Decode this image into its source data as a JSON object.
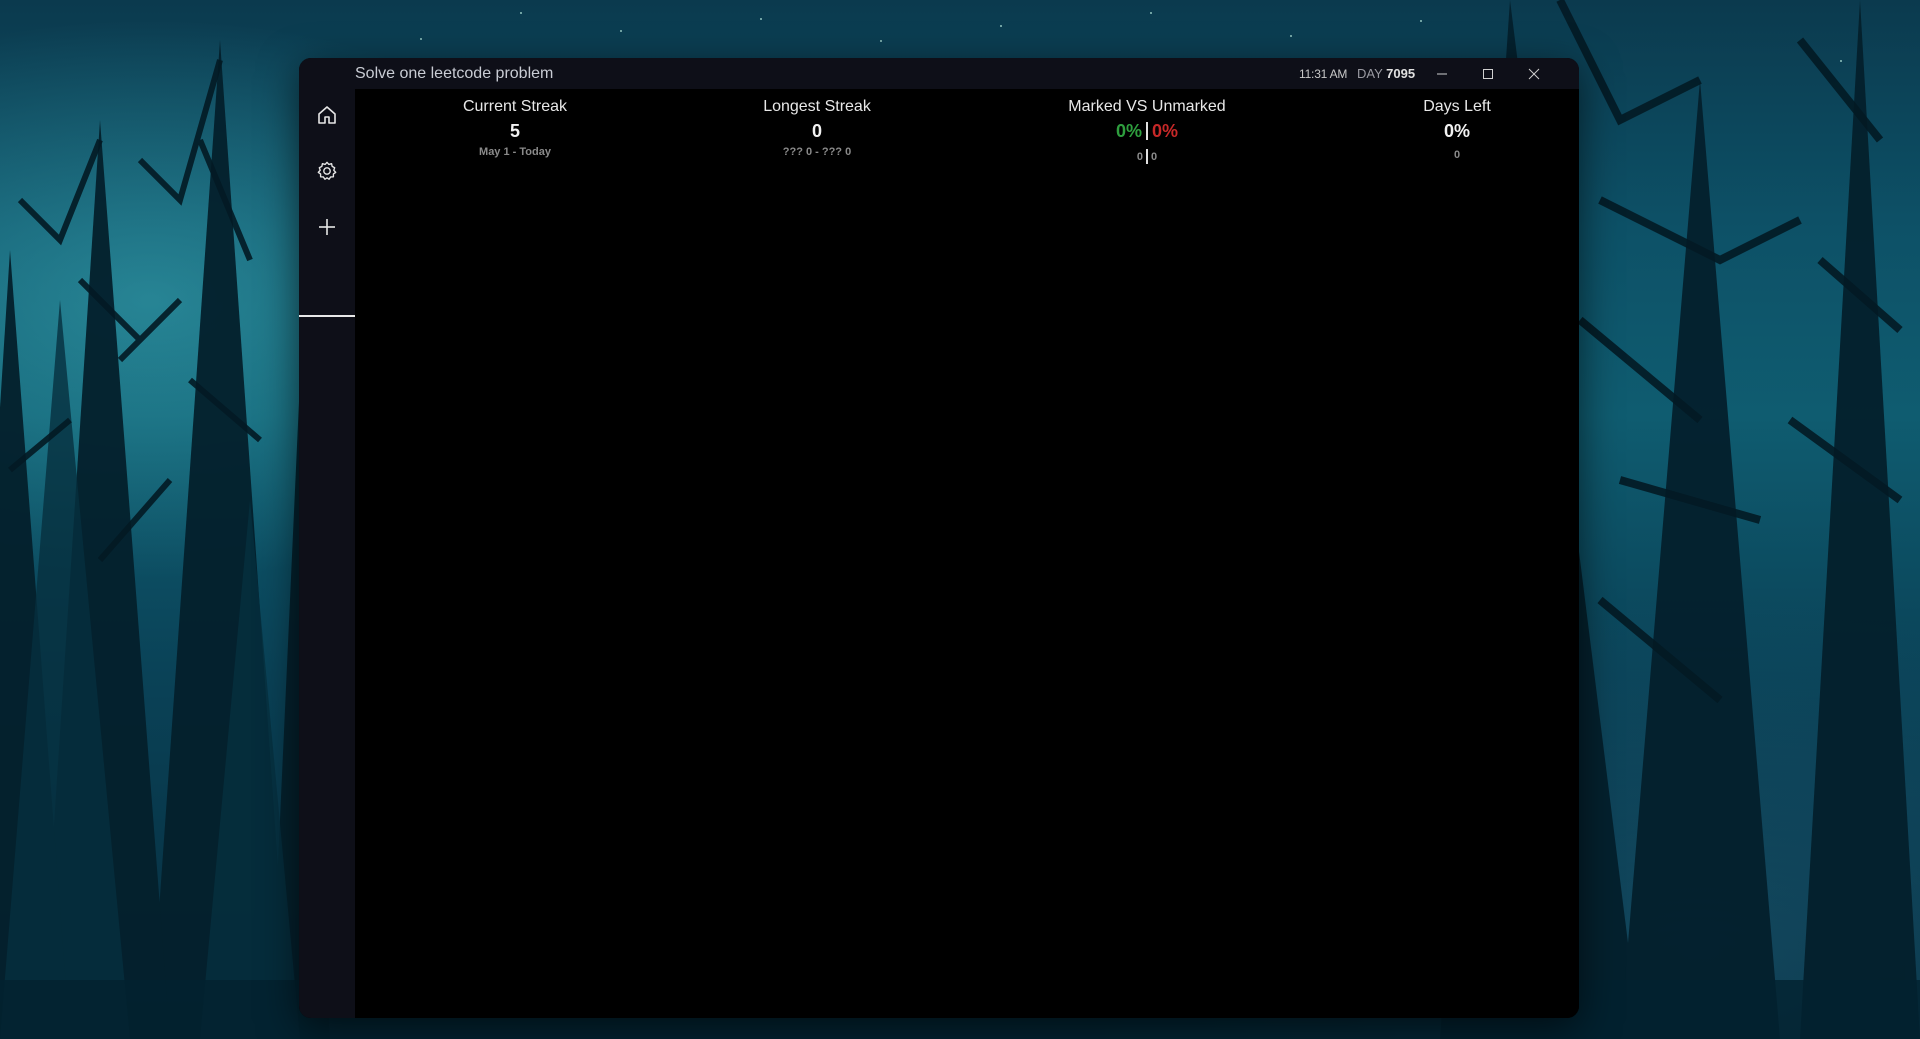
{
  "window": {
    "title": "Solve one leetcode problem",
    "time": "11:31 AM",
    "day_label": "DAY",
    "day_number": "7095"
  },
  "window_controls": {
    "minimize_icon": "minimize-icon",
    "maximize_icon": "maximize-icon",
    "close_icon": "close-icon"
  },
  "sidebar": {
    "items": [
      {
        "icon": "home-icon",
        "selected": false
      },
      {
        "icon": "gear-icon",
        "selected": false
      },
      {
        "icon": "plus-icon",
        "selected": true
      }
    ]
  },
  "stats": {
    "current_streak": {
      "title": "Current Streak",
      "value": "5",
      "range": "May 1 - Today"
    },
    "longest_streak": {
      "title": "Longest Streak",
      "value": "0",
      "range": "??? 0 - ??? 0"
    },
    "marked_vs_unmarked": {
      "title": "Marked VS Unmarked",
      "marked_pct": "0%",
      "unmarked_pct": "0%",
      "marked_count": "0",
      "unmarked_count": "0"
    },
    "days_left": {
      "title": "Days Left",
      "value": "0%",
      "count": "0"
    }
  },
  "colors": {
    "marked": "#2e9e3e",
    "unmarked": "#c62828",
    "window_bg": "#000000",
    "chrome_bg": "#0e0f18"
  }
}
